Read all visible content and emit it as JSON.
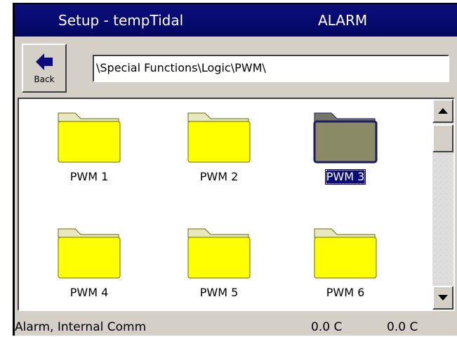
{
  "window": {
    "title": "Setup - tempTidal",
    "alarm_label": "ALARM"
  },
  "toolbar": {
    "back_label": "Back",
    "back_icon": "arrow-left-icon"
  },
  "path": {
    "value": "\\Special Functions\\Logic\\PWM\\"
  },
  "folders": [
    {
      "label": "PWM 1",
      "selected": false
    },
    {
      "label": "PWM 2",
      "selected": false
    },
    {
      "label": "PWM 3",
      "selected": true
    },
    {
      "label": "PWM 4",
      "selected": false
    },
    {
      "label": "PWM 5",
      "selected": false
    },
    {
      "label": "PWM 6",
      "selected": false
    }
  ],
  "status": {
    "message": "Alarm, Internal Comm",
    "value1": "0.0 C",
    "value2": "0.0 C"
  },
  "colors": {
    "titlebar": "#050a6e",
    "folder": "#ffff00",
    "folder_selected": "#8a8a66",
    "selection": "#0a0a7a"
  }
}
